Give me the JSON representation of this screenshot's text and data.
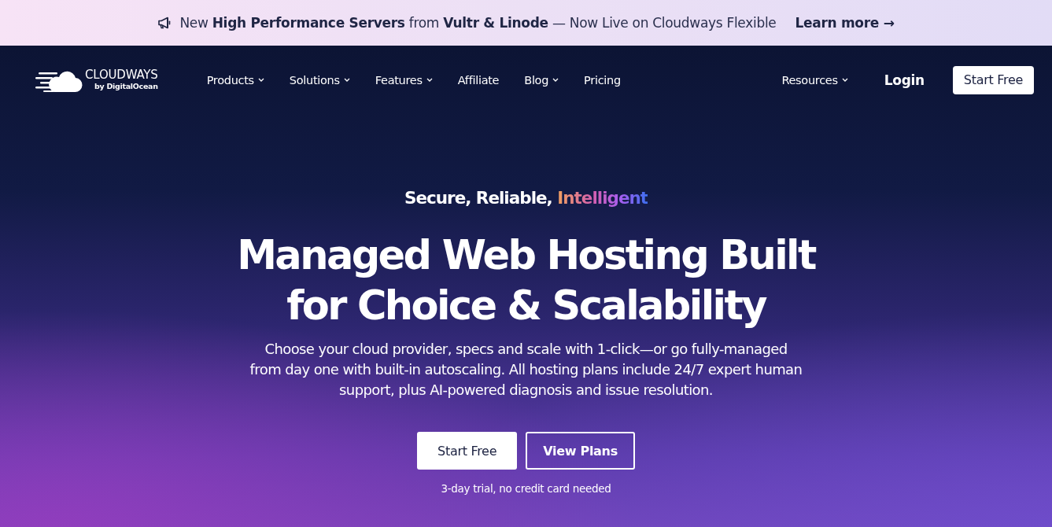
{
  "announcement": {
    "text": "New **High Performance Servers** from **Vultr & Linode** — Now Live on Cloudways Flexible",
    "link": "Learn more →"
  },
  "nav": {
    "logo": {
      "name": "CLOUDWAYS",
      "byline": "by DigitalOcean"
    },
    "items": [
      {
        "label": "Products",
        "dropdown": true
      },
      {
        "label": "Solutions",
        "dropdown": true
      },
      {
        "label": "Features",
        "dropdown": true
      },
      {
        "label": "Affiliate",
        "dropdown": false
      },
      {
        "label": "Blog",
        "dropdown": true
      },
      {
        "label": "Pricing",
        "dropdown": false
      }
    ],
    "right_items": [
      {
        "label": "Resources",
        "dropdown": true
      }
    ],
    "login": "Login",
    "cta": "Start Free"
  },
  "hero": {
    "tagline": {
      "text": "Secure, Reliable,",
      "highlight": "Intelligent"
    },
    "headline": "Managed Web Hosting Built for Choice & Scalability",
    "description": "Choose your cloud provider, specs and scale with 1-click—or go fully-managed from day one with built-in autoscaling. All hosting plans include 24/7 expert human support, plus AI-powered diagnosis and issue resolution.",
    "buttons": [
      {
        "label": "Start Free",
        "kind": "primary"
      },
      {
        "label": "View Plans",
        "kind": "outline"
      }
    ],
    "note": "3-day trial, no credit card needed"
  }
}
